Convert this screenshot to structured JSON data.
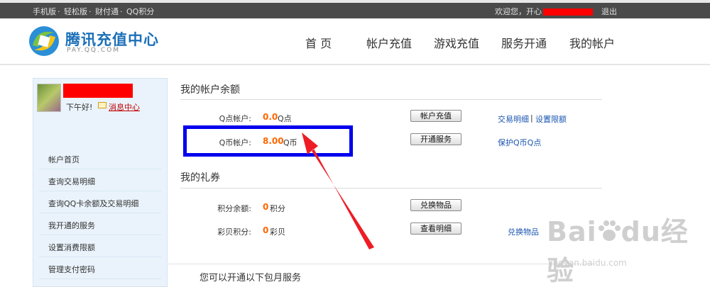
{
  "topbar": {
    "links": [
      "手机版",
      "轻松版",
      "财付通",
      "QQ积分"
    ],
    "separator": "·",
    "welcome": "欢迎您，开心",
    "logout": "退出"
  },
  "header": {
    "title": "腾讯充值中心",
    "subtitle": "PAY.QQ.COM",
    "nav": [
      "首 页",
      "帐户充值",
      "游戏充值",
      "服务开通",
      "我的帐户"
    ]
  },
  "sidebar": {
    "greeting": "下午好!",
    "message_center": "消息中心",
    "items": [
      "帐户首页",
      "查询交易明细",
      "查询QQ卡余额及交易明细",
      "我开通的服务",
      "设置消费限额",
      "管理支付密码"
    ]
  },
  "balance": {
    "title": "我的帐户余额",
    "rows": [
      {
        "label": "Q点帐户:",
        "value": "0.0",
        "unit": "Q点",
        "button": "帐户充值",
        "link1": "交易明细",
        "sep": "|",
        "link2": "设置限额"
      },
      {
        "label": "Q币帐户:",
        "value": "8.00",
        "unit": "Q币",
        "button": "开通服务",
        "link1": "保护Q币Q点"
      }
    ]
  },
  "coupons": {
    "title": "我的礼券",
    "rows": [
      {
        "label": "积分余额:",
        "value": "0",
        "unit": "积分",
        "button": "兑换物品"
      },
      {
        "label": "彩贝积分:",
        "value": "0",
        "unit": "彩贝",
        "button": "查看明细",
        "link1": "兑换物品"
      }
    ]
  },
  "bottom": {
    "text": "您可以开通以下包月服务"
  },
  "watermark": {
    "brand": "Bai",
    "brand2": "du",
    "cn": "经验",
    "site": "jingyan.baidu.com"
  },
  "colors": {
    "accent": "#1b6fb8",
    "value": "#ff6600",
    "highlight": "#0000ee",
    "arrow": "#ee1c25",
    "redaction": "#ff0000"
  }
}
